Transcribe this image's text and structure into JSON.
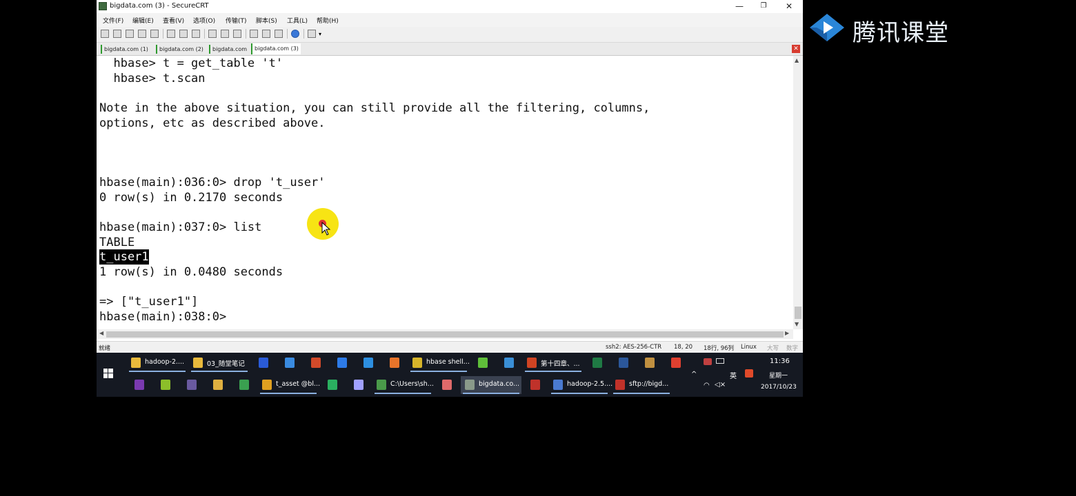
{
  "window": {
    "title": "bigdata.com (3) - SecureCRT",
    "controls": {
      "minimize": "—",
      "restore": "❐",
      "close": "✕"
    }
  },
  "menu": [
    "文件(F)",
    "编辑(E)",
    "查看(V)",
    "选项(O)",
    "传输(T)",
    "脚本(S)",
    "工具(L)",
    "帮助(H)"
  ],
  "tabs": [
    "bigdata.com (1)",
    "bigdata.com (2)",
    "bigdata.com",
    "bigdata.com (3)"
  ],
  "tab_close": "✕",
  "terminal": {
    "lines": [
      "  hbase> t = get_table 't'",
      "  hbase> t.scan",
      "",
      "Note in the above situation, you can still provide all the filtering, columns,",
      "options, etc as described above.",
      "",
      "",
      "",
      "hbase(main):036:0> drop 't_user'",
      "0 row(s) in 0.2170 seconds",
      "",
      "hbase(main):037:0> list",
      "TABLE",
      "t_user1",
      "1 row(s) in 0.0480 seconds",
      "",
      "=> [\"t_user1\"]",
      "hbase(main):038:0>"
    ]
  },
  "statusbar": {
    "ready": "就绪",
    "cipher": "ssh2: AES-256-CTR",
    "position": "18,  20",
    "size": "18行, 96列",
    "os": "Linux",
    "caps": "大写",
    "num": "数字"
  },
  "taskbar": {
    "top_row": [
      {
        "label": "hadoop-2....",
        "icon": "folder-icon",
        "color": "#e8b93c"
      },
      {
        "label": "03_随堂笔记",
        "icon": "folder-icon",
        "color": "#e8b93c"
      },
      {
        "label": "",
        "icon": "g-app-icon",
        "color": "#2a5bd7"
      },
      {
        "label": "",
        "icon": "network-icon",
        "color": "#3a8be0"
      },
      {
        "label": "",
        "icon": "cup-icon",
        "color": "#d24a2a"
      },
      {
        "label": "",
        "icon": "k-app-icon",
        "color": "#2d7be8"
      },
      {
        "label": "",
        "icon": "ie-icon",
        "color": "#2d8fe0"
      },
      {
        "label": "",
        "icon": "firefox-icon",
        "color": "#e8742a"
      },
      {
        "label": "hbase shell...",
        "icon": "chrome-icon",
        "color": "#d6b42a"
      },
      {
        "label": "",
        "icon": "green-app-icon",
        "color": "#5fbf3a"
      },
      {
        "label": "",
        "icon": "bird-icon",
        "color": "#3a8fd6"
      },
      {
        "label": "第十四章、...",
        "icon": "powerpoint-icon",
        "color": "#d04423"
      },
      {
        "label": "",
        "icon": "excel-icon",
        "color": "#1f7a44"
      },
      {
        "label": "",
        "icon": "word-icon",
        "color": "#2b579a"
      },
      {
        "label": "",
        "icon": "cube-icon",
        "color": "#c09040"
      },
      {
        "label": "",
        "icon": "xmind-icon",
        "color": "#e04030"
      }
    ],
    "bottom_row": [
      {
        "label": "",
        "icon": "axure-icon",
        "color": "#7a3ab0"
      },
      {
        "label": "",
        "icon": "green-circle-icon",
        "color": "#8cbf2a"
      },
      {
        "label": "",
        "icon": "eclipse-icon",
        "color": "#6a5aa0"
      },
      {
        "label": "",
        "icon": "hand-icon",
        "color": "#e0b040"
      },
      {
        "label": "",
        "icon": "blocks-icon",
        "color": "#3aa050"
      },
      {
        "label": "t_asset @bl...",
        "icon": "db-icon",
        "color": "#e0a020"
      },
      {
        "label": "",
        "icon": "pycharm-icon",
        "color": "#2ab060"
      },
      {
        "label": "",
        "icon": "idea-icon",
        "color": "#a0a0ff"
      },
      {
        "label": "C:\\Users\\sh...",
        "icon": "notepad-icon",
        "color": "#4a9a4a"
      },
      {
        "label": "",
        "icon": "eraser-icon",
        "color": "#e06a6a"
      },
      {
        "label": "bigdata.co...",
        "icon": "securecrt-icon",
        "color": "#8a9a8a",
        "active": true
      },
      {
        "label": "",
        "icon": "filezilla-icon",
        "color": "#c0322a"
      },
      {
        "label": "hadoop-2.5....",
        "icon": "vm-icon",
        "color": "#4a7ad0"
      },
      {
        "label": "sftp://bigd...",
        "icon": "filezilla-icon",
        "color": "#c0322a"
      }
    ],
    "tray": {
      "time": "11:36",
      "weekday": "星期一",
      "date": "2017/10/23",
      "ime": "英",
      "chevron": "^"
    }
  },
  "brand": {
    "text": "腾讯课堂",
    "accent": "#1f7fd0"
  }
}
